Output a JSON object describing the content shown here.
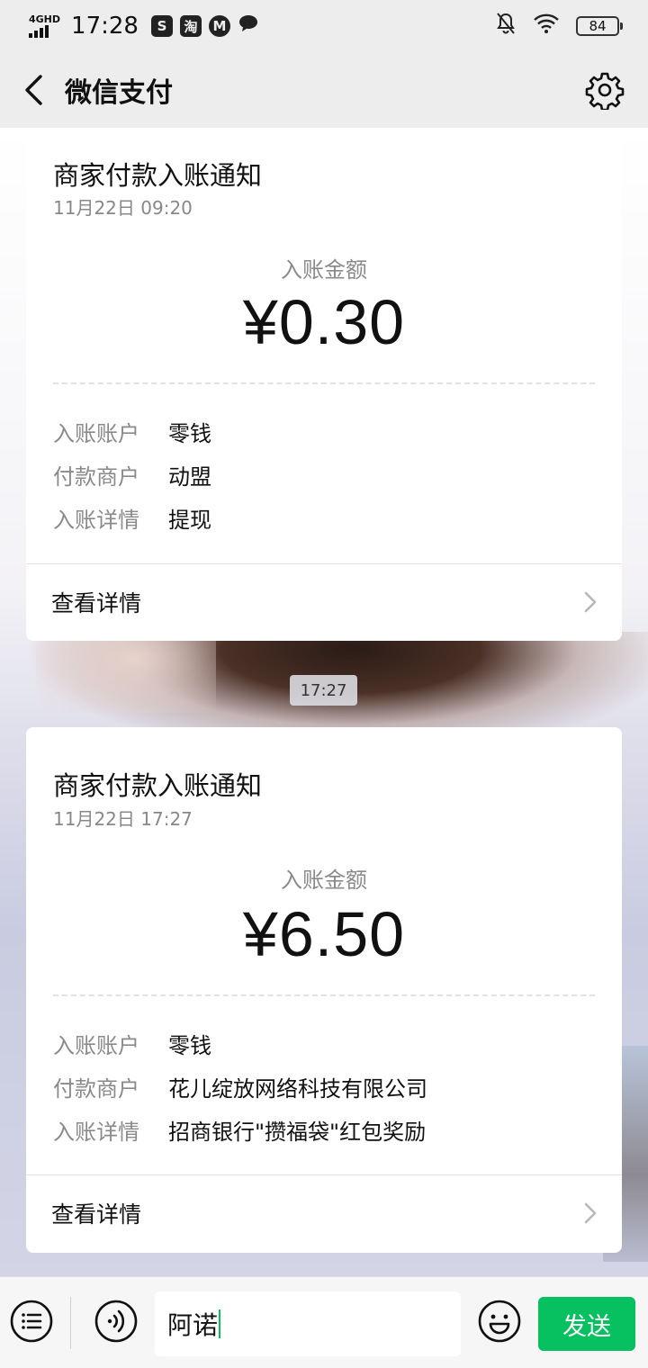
{
  "status_bar": {
    "network": "4GHD",
    "time": "17:28",
    "app_icons": [
      "S",
      "淘",
      "M"
    ],
    "battery": "84"
  },
  "header": {
    "title": "微信支付"
  },
  "messages": [
    {
      "title": "商家付款入账通知",
      "date": "11月22日  09:20",
      "amount_label": "入账金额",
      "amount": "¥0.30",
      "rows": [
        {
          "key": "入账账户",
          "value": "零钱"
        },
        {
          "key": "付款商户",
          "value": "动盟"
        },
        {
          "key": "入账详情",
          "value": "提现"
        }
      ],
      "link": "查看详情"
    },
    {
      "title": "商家付款入账通知",
      "date": "11月22日  17:27",
      "amount_label": "入账金额",
      "amount": "¥6.50",
      "rows": [
        {
          "key": "入账账户",
          "value": "零钱"
        },
        {
          "key": "付款商户",
          "value": "花儿绽放网络科技有限公司"
        },
        {
          "key": "入账详情",
          "value": "招商银行\"攒福袋\"红包奖励"
        }
      ],
      "link": "查看详情"
    }
  ],
  "time_separator": "17:27",
  "input_bar": {
    "text": "阿诺",
    "send_label": "发送"
  },
  "colors": {
    "accent": "#07c160",
    "background": "#ededed",
    "card": "#ffffff"
  }
}
